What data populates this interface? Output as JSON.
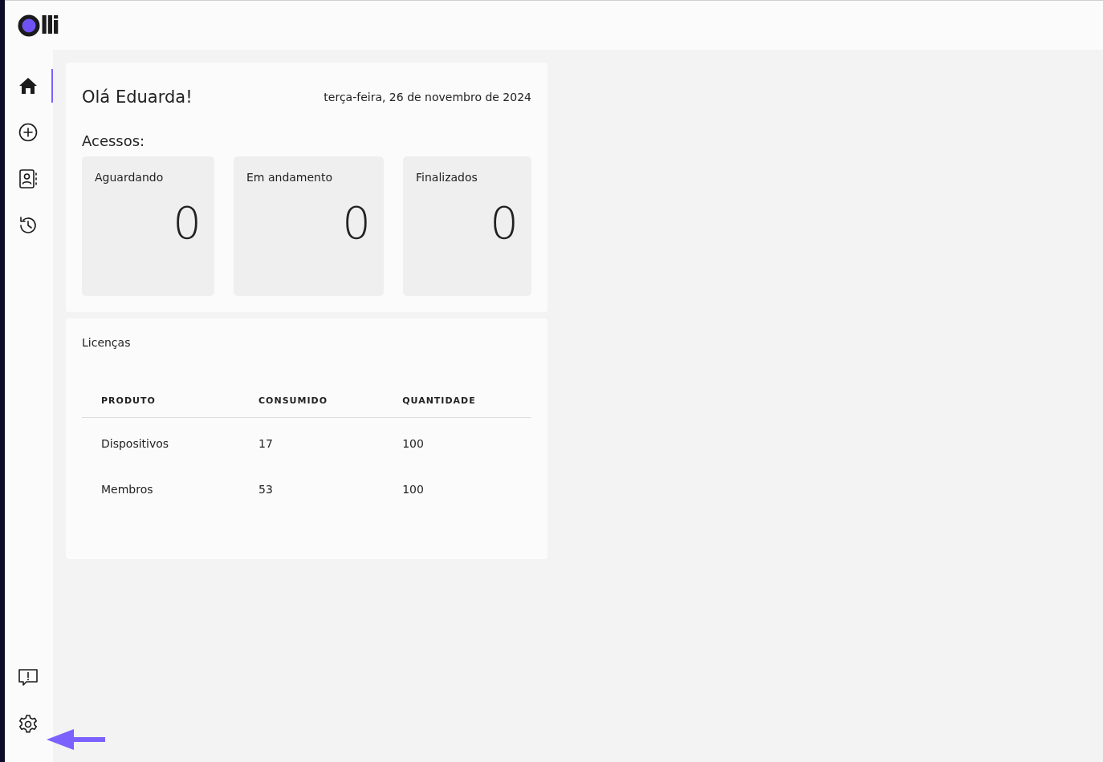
{
  "header": {
    "logo_text": "lli"
  },
  "sidebar": {
    "items": [
      {
        "kind": "home",
        "selected": true
      },
      {
        "kind": "add",
        "selected": false
      },
      {
        "kind": "contacts",
        "selected": false
      },
      {
        "kind": "history",
        "selected": false
      }
    ],
    "bottom_items": [
      {
        "kind": "feedback",
        "selected": false
      },
      {
        "kind": "settings",
        "selected": false
      }
    ]
  },
  "greeting": {
    "title": "Olá Eduarda!",
    "date": "terça-feira, 26 de novembro de 2024",
    "section_label": "Acessos:",
    "stats": [
      {
        "label": "Aguardando",
        "value": "0"
      },
      {
        "label": "Em andamento",
        "value": "0"
      },
      {
        "label": "Finalizados",
        "value": "0"
      }
    ]
  },
  "licenses": {
    "title": "Licenças",
    "table": {
      "columns": [
        "PRODUTO",
        "CONSUMIDO",
        "QUANTIDADE"
      ],
      "rows": [
        [
          "Dispositivos",
          "17",
          "100"
        ],
        [
          "Membros",
          "53",
          "100"
        ]
      ]
    }
  }
}
